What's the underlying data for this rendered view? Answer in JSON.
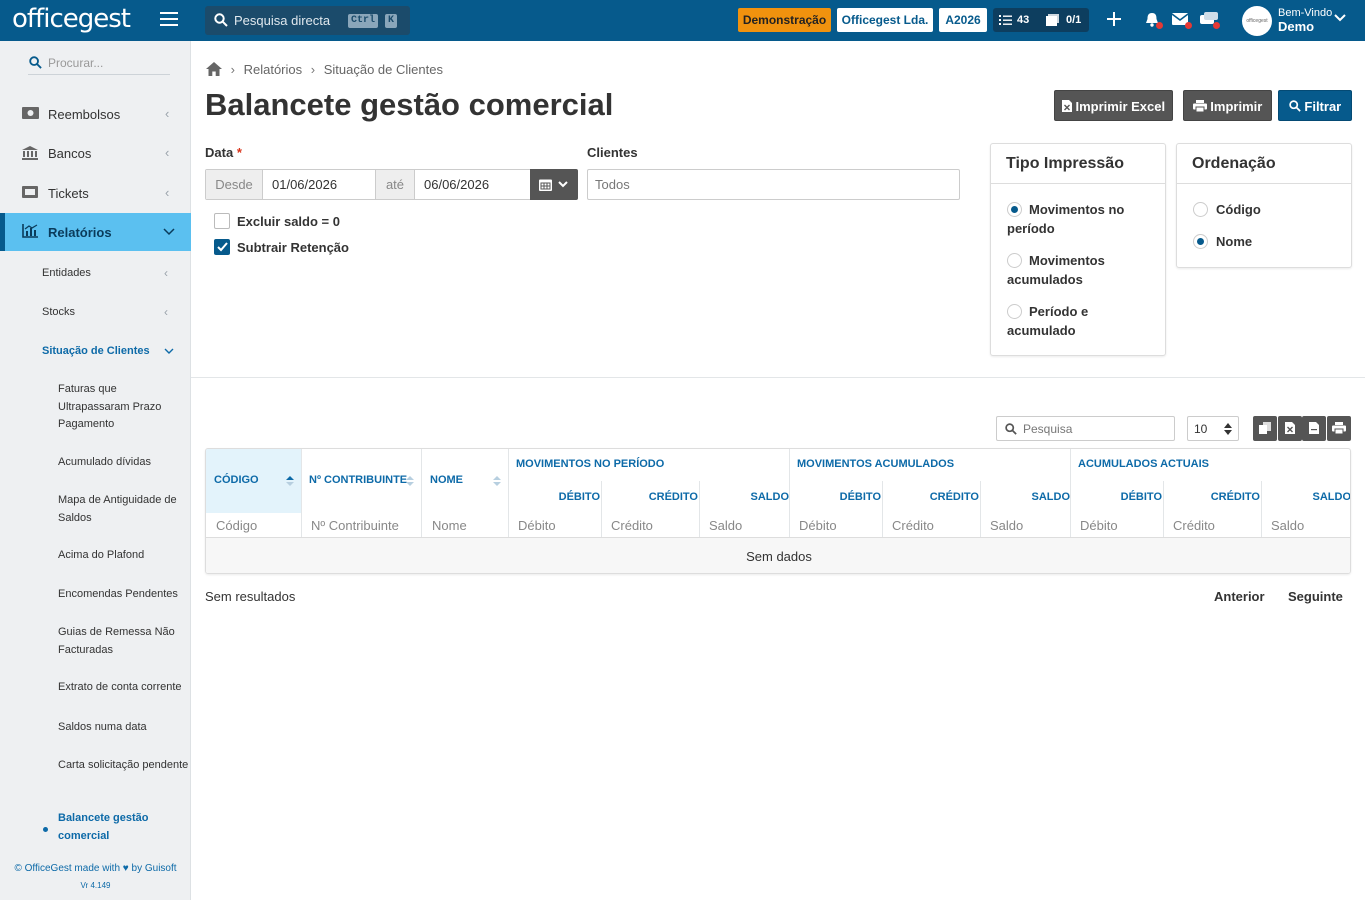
{
  "topbar": {
    "logo": "officegest",
    "search_label": "Pesquisa directa",
    "shortcut_keys": [
      "Ctrl",
      "K"
    ],
    "demo_badge": "Demonstração",
    "company": "Officegest Lda.",
    "year": "A2026",
    "tasks_count": "43",
    "docs_count": "0/1",
    "welcome": "Bem-Vindo",
    "user": "Demo",
    "accent_color": "#065a8c",
    "demo_color": "#f0920e"
  },
  "sidebar": {
    "search_placeholder": "Procurar...",
    "items": [
      {
        "label": "Reembolsos",
        "icon": "money-icon"
      },
      {
        "label": "Bancos",
        "icon": "bank-icon"
      },
      {
        "label": "Tickets",
        "icon": "ticket-icon"
      },
      {
        "label": "Relatórios",
        "icon": "chart-icon"
      }
    ],
    "sub": [
      "Entidades",
      "Stocks",
      "Situação de Clientes"
    ],
    "reports": [
      "Faturas que Ultrapassaram Prazo Pagamento",
      "Acumulado dívidas",
      "Mapa de Antiguidade de Saldos",
      "Acima do Plafond",
      "Encomendas Pendentes",
      "Guias de Remessa Não Facturadas",
      "Extrato de conta corrente",
      "Saldos numa data",
      "Carta solicitação pendente",
      "Balancete gestão comercial"
    ],
    "footer_prefix": "© OfficeGest made with",
    "footer_suffix": "by Guisoft",
    "version": "Vr 4.149"
  },
  "breadcrumb": {
    "level1": "Relatórios",
    "level2": "Situação de Clientes"
  },
  "page_title": "Balancete gestão comercial",
  "actions": {
    "excel": "Imprimir Excel",
    "print": "Imprimir",
    "filter": "Filtrar"
  },
  "filters": {
    "date_label": "Data",
    "required_mark": "*",
    "from_label": "Desde",
    "from_value": "01/06/2026",
    "to_label": "até",
    "to_value": "06/06/2026",
    "clients_label": "Clientes",
    "clients_value": "Todos",
    "exclude_zero": {
      "label": "Excluir saldo = 0",
      "checked": false
    },
    "subtract_retention": {
      "label": "Subtrair Retenção",
      "checked": true
    }
  },
  "print_type": {
    "title": "Tipo Impressão",
    "options": [
      "Movimentos no período",
      "Movimentos acumulados",
      "Período e acumulado"
    ],
    "selected": "Movimentos no período"
  },
  "ordering": {
    "title": "Ordenação",
    "options": [
      "Código",
      "Nome"
    ],
    "selected": "Nome"
  },
  "table": {
    "search_placeholder": "Pesquisa",
    "page_size": "10",
    "columns": [
      "Código",
      "Nº Contribuinte",
      "Nome"
    ],
    "groups": [
      "Movimentos no Período",
      "Movimentos Acumulados",
      "Acumulados Actuais"
    ],
    "subcolumns": [
      "Débito",
      "Crédito",
      "Saldo"
    ],
    "filters": [
      "Código",
      "Nº Contribuinte",
      "Nome",
      "Débito",
      "Crédito",
      "Saldo",
      "Débito",
      "Crédito",
      "Saldo",
      "Débito",
      "Crédito",
      "Saldo"
    ],
    "empty": "Sem dados",
    "no_results": "Sem resultados",
    "prev": "Anterior",
    "next": "Seguinte"
  }
}
